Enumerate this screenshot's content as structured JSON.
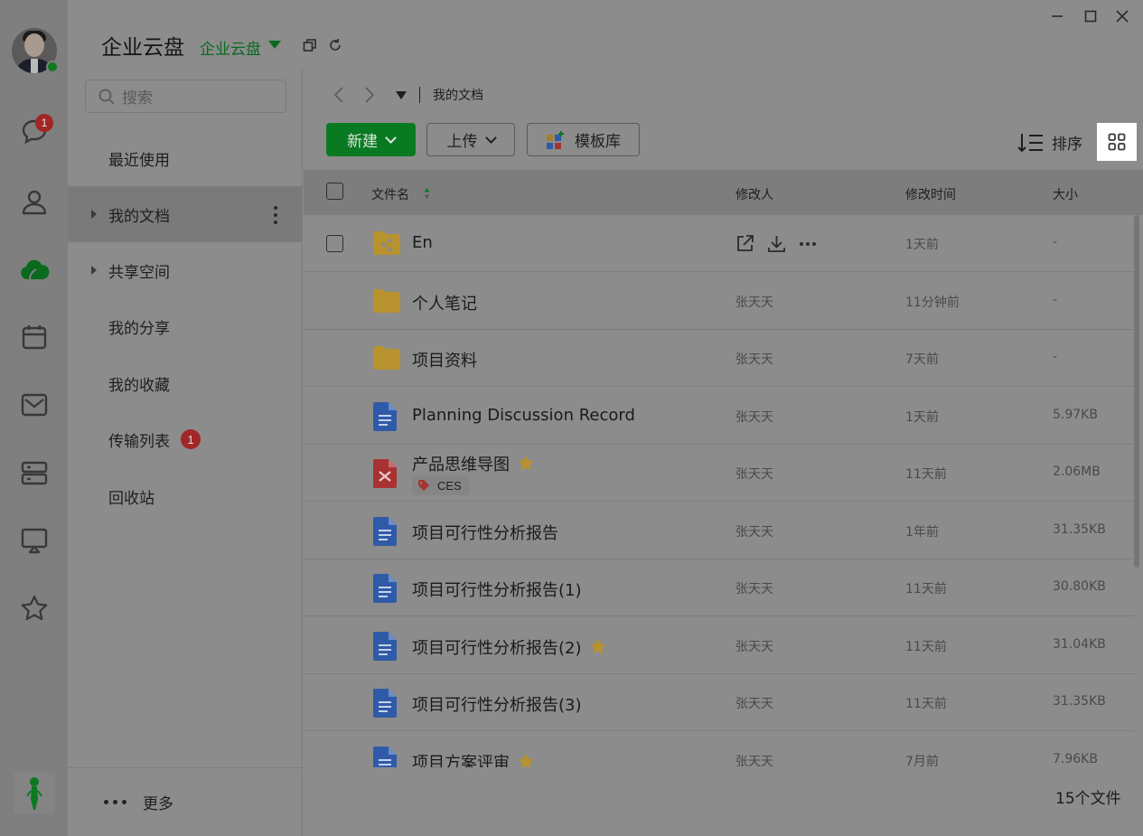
{
  "app": {
    "title": "企业云盘",
    "workspace": "企业云盘"
  },
  "rail": {
    "chat_badge": "1"
  },
  "nav": {
    "search_placeholder": "搜索",
    "items": [
      {
        "label": "最近使用"
      },
      {
        "label": "我的文档"
      },
      {
        "label": "共享空间"
      },
      {
        "label": "我的分享"
      },
      {
        "label": "我的收藏"
      },
      {
        "label": "传输列表",
        "badge": "1"
      },
      {
        "label": "回收站"
      }
    ],
    "more_label": "更多"
  },
  "breadcrumb": {
    "current": "我的文档"
  },
  "toolbar": {
    "new_label": "新建",
    "upload_label": "上传",
    "template_label": "模板库",
    "sort_label": "排序"
  },
  "table": {
    "columns": {
      "name": "文件名",
      "modifier": "修改人",
      "modified_time": "修改时间",
      "size": "大小"
    },
    "rows": [
      {
        "name": "En",
        "modifier": "",
        "time": "1天前",
        "size": "-",
        "type": "shared-folder"
      },
      {
        "name": "个人笔记",
        "modifier": "张天天",
        "time": "11分钟前",
        "size": "-",
        "type": "folder"
      },
      {
        "name": "项目资料",
        "modifier": "张天天",
        "time": "7天前",
        "size": "-",
        "type": "folder"
      },
      {
        "name": "Planning Discussion Record",
        "modifier": "张天天",
        "time": "1天前",
        "size": "5.97KB",
        "type": "doc"
      },
      {
        "name": "产品思维导图",
        "modifier": "张天天",
        "time": "11天前",
        "size": "2.06MB",
        "type": "mindmap",
        "tag": "CES"
      },
      {
        "name": "项目可行性分析报告",
        "modifier": "张天天",
        "time": "1年前",
        "size": "31.35KB",
        "type": "doc"
      },
      {
        "name": "项目可行性分析报告(1)",
        "modifier": "张天天",
        "time": "11天前",
        "size": "30.80KB",
        "type": "doc"
      },
      {
        "name": "项目可行性分析报告(2)",
        "modifier": "张天天",
        "time": "11天前",
        "size": "31.04KB",
        "type": "doc"
      },
      {
        "name": "项目可行性分析报告(3)",
        "modifier": "张天天",
        "time": "11天前",
        "size": "31.35KB",
        "type": "doc"
      },
      {
        "name": "项目方案评审",
        "modifier": "张天天",
        "time": "7月前",
        "size": "7.96KB",
        "type": "doc"
      }
    ],
    "footer_count": "15个文件"
  },
  "colors": {
    "accent_green": "#0a7a22",
    "badge_red": "#a12626",
    "folder_yellow": "#b8922e",
    "doc_blue": "#2f5aa8",
    "mindmap_red": "#a83232",
    "star_gold": "#b8922e"
  }
}
